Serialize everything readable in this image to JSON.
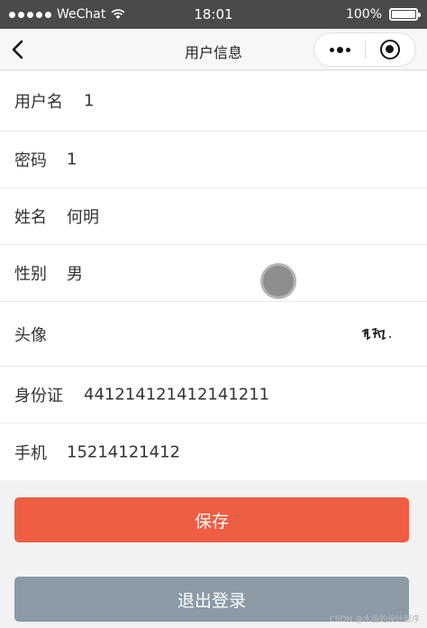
{
  "status_bar": {
    "carrier": "WeChat",
    "time": "18:01",
    "battery": "100%"
  },
  "nav": {
    "title": "用户信息"
  },
  "fields": [
    {
      "label": "用户名",
      "value": "1"
    },
    {
      "label": "密码",
      "value": "1"
    },
    {
      "label": "姓名",
      "value": "何明"
    },
    {
      "label": "性别",
      "value": "男"
    },
    {
      "label": "头像",
      "value": ""
    },
    {
      "label": "身份证",
      "value": "441214121412141211"
    },
    {
      "label": "手机",
      "value": "15214121412"
    }
  ],
  "buttons": {
    "save": "保存",
    "logout": "退出登录"
  },
  "watermark": "CSDN @水恒的设计程序",
  "colors": {
    "save": "#ef5d42",
    "logout": "#8b9aa5",
    "status_bar": "#4a4a4a"
  }
}
